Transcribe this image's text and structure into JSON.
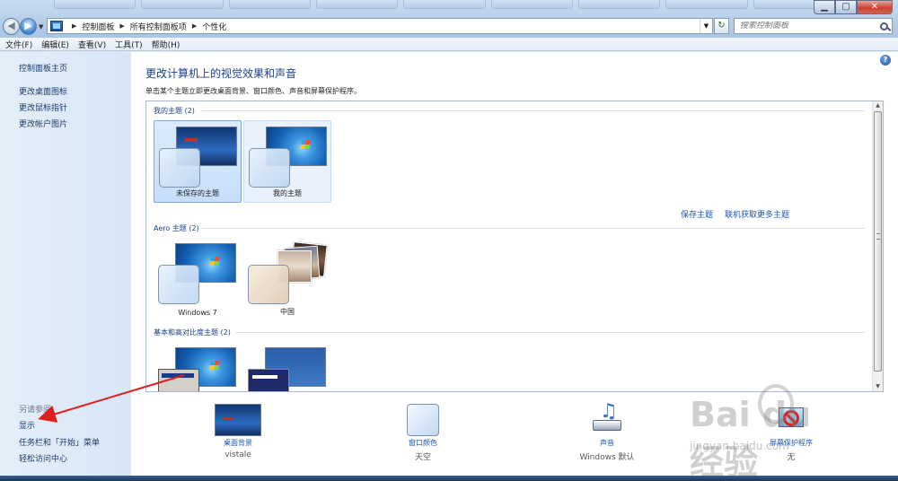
{
  "window": {
    "minimize": "▁",
    "maximize": "▢",
    "close": "✕"
  },
  "address": {
    "crumbs": [
      "控制面板",
      "所有控制面板项",
      "个性化"
    ],
    "search_placeholder": "搜索控制面板"
  },
  "menu": [
    "文件(F)",
    "编辑(E)",
    "查看(V)",
    "工具(T)",
    "帮助(H)"
  ],
  "sidebar": {
    "home": "控制面板主页",
    "links": [
      "更改桌面图标",
      "更改鼠标指针",
      "更改帐户图片"
    ],
    "see_also_title": "另请参阅",
    "see_also": [
      "显示",
      "任务栏和「开始」菜单",
      "轻松访问中心"
    ]
  },
  "main": {
    "title": "更改计算机上的视觉效果和声音",
    "description": "单击某个主题立即更改桌面背景、窗口颜色、声音和屏幕保护程序。",
    "my_themes": {
      "title": "我的主题 (2)",
      "themes": [
        "未保存的主题",
        "我的主题"
      ],
      "save_link": "保存主题",
      "online_link": "联机获取更多主题"
    },
    "aero_themes": {
      "title": "Aero 主题 (2)",
      "themes": [
        "Windows 7",
        "中国"
      ]
    },
    "basic_themes": {
      "title": "基本和高对比度主题 (2)"
    }
  },
  "settings": [
    {
      "label": "桌面背景",
      "value": "vistale"
    },
    {
      "label": "窗口颜色",
      "value": "天空"
    },
    {
      "label": "声音",
      "value": "Windows 默认"
    },
    {
      "label": "屏幕保护程序",
      "value": "无"
    }
  ],
  "watermark": {
    "text": "Bai du 经验",
    "url": "jingyan.baidu.com"
  },
  "colors": {
    "link": "#1c56b4",
    "title": "#1d3f8a",
    "annotation_arrow": "#e02020"
  }
}
